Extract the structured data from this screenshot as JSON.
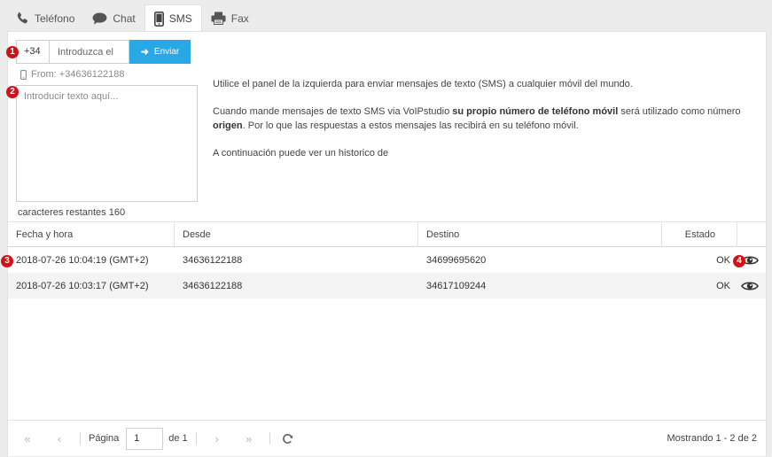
{
  "tabs": [
    {
      "label": "Teléfono",
      "icon": "phone-icon"
    },
    {
      "label": "Chat",
      "icon": "chat-bubble-icon"
    },
    {
      "label": "SMS",
      "icon": "mobile-phone-icon",
      "active": true
    },
    {
      "label": "Fax",
      "icon": "printer-icon"
    }
  ],
  "sms_form": {
    "prefix": "+34",
    "number_placeholder": "Introduzca el",
    "send_label": "Enviar",
    "from_label": "From: +34636122188",
    "message_placeholder": "Introducir texto aquí...",
    "remaining_label": "caracteres restantes 160"
  },
  "info": {
    "line1": "Utilice el panel de la izquierda para enviar mensajes de texto (SMS) a cualquier móvil del mundo.",
    "line2_a": "Cuando mande mensajes de texto SMS via VoIPstudio ",
    "line2_b": "su propio número de teléfono móvil",
    "line2_c": " será utilizado como número ",
    "line2_d": "origen",
    "line2_e": ". Por lo que las respuestas a estos mensajes las recibirá en su teléfono móvil.",
    "line3": "A continuación puede ver un historico de"
  },
  "table": {
    "headers": [
      "Fecha y hora",
      "Desde",
      "Destino",
      "Estado"
    ],
    "rows": [
      {
        "datetime": "2018-07-26 10:04:19 (GMT+2)",
        "from": "34636122188",
        "to": "34699695620",
        "status": "OK"
      },
      {
        "datetime": "2018-07-26 10:03:17 (GMT+2)",
        "from": "34636122188",
        "to": "34617109244",
        "status": "OK"
      }
    ]
  },
  "pager": {
    "page_label": "Página",
    "page_value": "1",
    "of_label": "de 1",
    "showing": "Mostrando 1 - 2 de 2"
  },
  "markers": [
    "1",
    "2",
    "3",
    "4"
  ],
  "colors": {
    "accent": "#29a8e6",
    "marker": "#d0131b",
    "icon": "#555555"
  }
}
